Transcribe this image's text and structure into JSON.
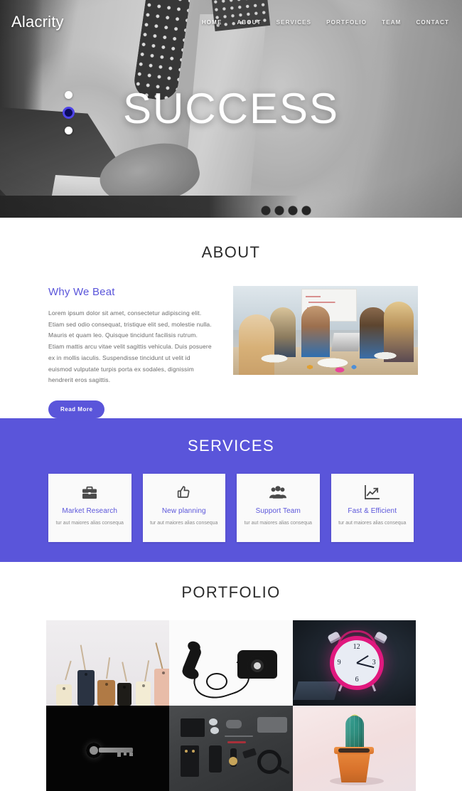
{
  "site": {
    "logo": "Alacrity"
  },
  "nav": {
    "items": [
      {
        "label": "HOME",
        "active": true
      },
      {
        "label": "ABOUT",
        "active": false
      },
      {
        "label": "SERVICES",
        "active": false
      },
      {
        "label": "PORTFOLIO",
        "active": false
      },
      {
        "label": "TEAM",
        "active": false
      },
      {
        "label": "CONTACT",
        "active": false
      }
    ]
  },
  "hero": {
    "title": "SUCCESS",
    "slider_dots": 3,
    "active_dot_index": 1,
    "active_dot_color": "#0c0c5e"
  },
  "about": {
    "section_title": "ABOUT",
    "heading": "Why We Beat",
    "heading_color": "#5a55da",
    "paragraph": "Lorem ipsum dolor sit amet, consectetur adipiscing elit. Etiam sed odio consequat, tristique elit sed, molestie nulla. Mauris et quam leo. Quisque tincidunt facilisis rutrum. Etiam mattis arcu vitae velit sagittis vehicula. Duis posuere ex in mollis iaculis. Suspendisse tincidunt ut velit id euismod vulputate turpis porta ex sodales, dignissim hendrerit eros sagittis.",
    "button_label": "Read More",
    "image_alt": "team meeting around table"
  },
  "services": {
    "section_title": "SERVICES",
    "background_color": "#5a55da",
    "cards": [
      {
        "icon": "briefcase-icon",
        "title": "Market Research",
        "text": "tur aut maiores alias consequa"
      },
      {
        "icon": "thumbs-up-icon",
        "title": "New planning",
        "text": "tur aut maiores alias consequa"
      },
      {
        "icon": "users-group-icon",
        "title": "Support Team",
        "text": "tur aut maiores alias consequa"
      },
      {
        "icon": "growth-chart-icon",
        "title": "Fast & Efficient",
        "text": "tur aut maiores alias consequa"
      }
    ]
  },
  "portfolio": {
    "section_title": "PORTFOLIO",
    "items": [
      {
        "alt": "price tags on white background"
      },
      {
        "alt": "black rotary telephone with cord"
      },
      {
        "alt": "pink alarm clock in dark room"
      },
      {
        "alt": "silver key on black background"
      },
      {
        "alt": "flat lay of mens accessories"
      },
      {
        "alt": "cactus in orange pot"
      }
    ]
  },
  "clock": {
    "numbers": [
      "12",
      "3",
      "6",
      "9"
    ]
  }
}
